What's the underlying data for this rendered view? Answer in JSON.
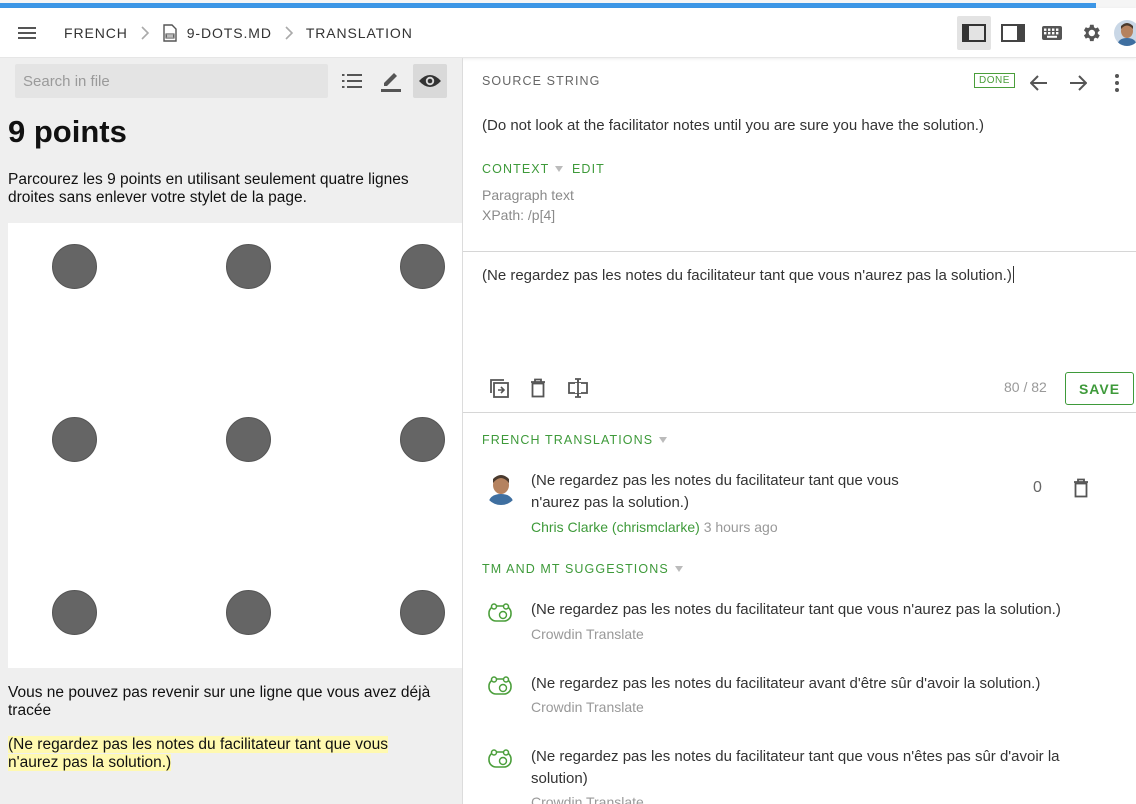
{
  "colors": {
    "accent_blue": "#3c96e6",
    "accent_green": "#3e9a3a",
    "highlight": "#fff9b0",
    "dot": "#656565"
  },
  "progress": {
    "percent": 96.5
  },
  "header": {
    "breadcrumbs": [
      "FRENCH",
      "9-DOTS.MD",
      "TRANSLATION"
    ],
    "icons": [
      "menu-icon",
      "chevron-right-icon",
      "file-icon",
      "layout-left-icon",
      "layout-right-icon",
      "keyboard-icon",
      "gear-icon",
      "avatar"
    ]
  },
  "left": {
    "search_placeholder": "Search in file",
    "title": "9 points",
    "intro": "Parcourez les 9 points en utilisant seulement quatre lignes droites sans enlever votre stylet de la page.",
    "rule": "Vous ne pouvez pas revenir sur une ligne que vous avez déjà tracée",
    "highlighted": "(Ne regardez pas les notes du facilitateur tant que vous n'aurez pas la solution.)",
    "dots_count": 9
  },
  "source": {
    "label": "SOURCE STRING",
    "badge": "DONE",
    "text": "(Do not look at the facilitator notes until you are sure you have the solution.)",
    "context_label": "CONTEXT",
    "edit_label": "EDIT",
    "context_lines": [
      "Paragraph text",
      "XPath: /p[4]"
    ]
  },
  "editor": {
    "translation": "(Ne regardez pas les notes du facilitateur tant que vous n'aurez pas la solution.)",
    "counter": "80 / 82",
    "save_label": "SAVE"
  },
  "translations": {
    "label": "FRENCH TRANSLATIONS",
    "items": [
      {
        "text": "(Ne regardez pas les notes du facilitateur tant que vous n'aurez pas la solution.)",
        "author": "Chris Clarke (chrismclarke)",
        "time": "3 hours ago",
        "votes": "0"
      }
    ]
  },
  "suggestions": {
    "label": "TM AND MT SUGGESTIONS",
    "items": [
      {
        "text": "(Ne regardez pas les notes du facilitateur tant que vous n'aurez pas la solution.)",
        "source": "Crowdin Translate"
      },
      {
        "text": "(Ne regardez pas les notes du facilitateur avant d'être sûr d'avoir la solution.)",
        "source": "Crowdin Translate"
      },
      {
        "text": "(Ne regardez pas les notes du facilitateur tant que vous n'êtes pas sûr d'avoir la solution)",
        "source": "Crowdin Translate"
      }
    ]
  }
}
